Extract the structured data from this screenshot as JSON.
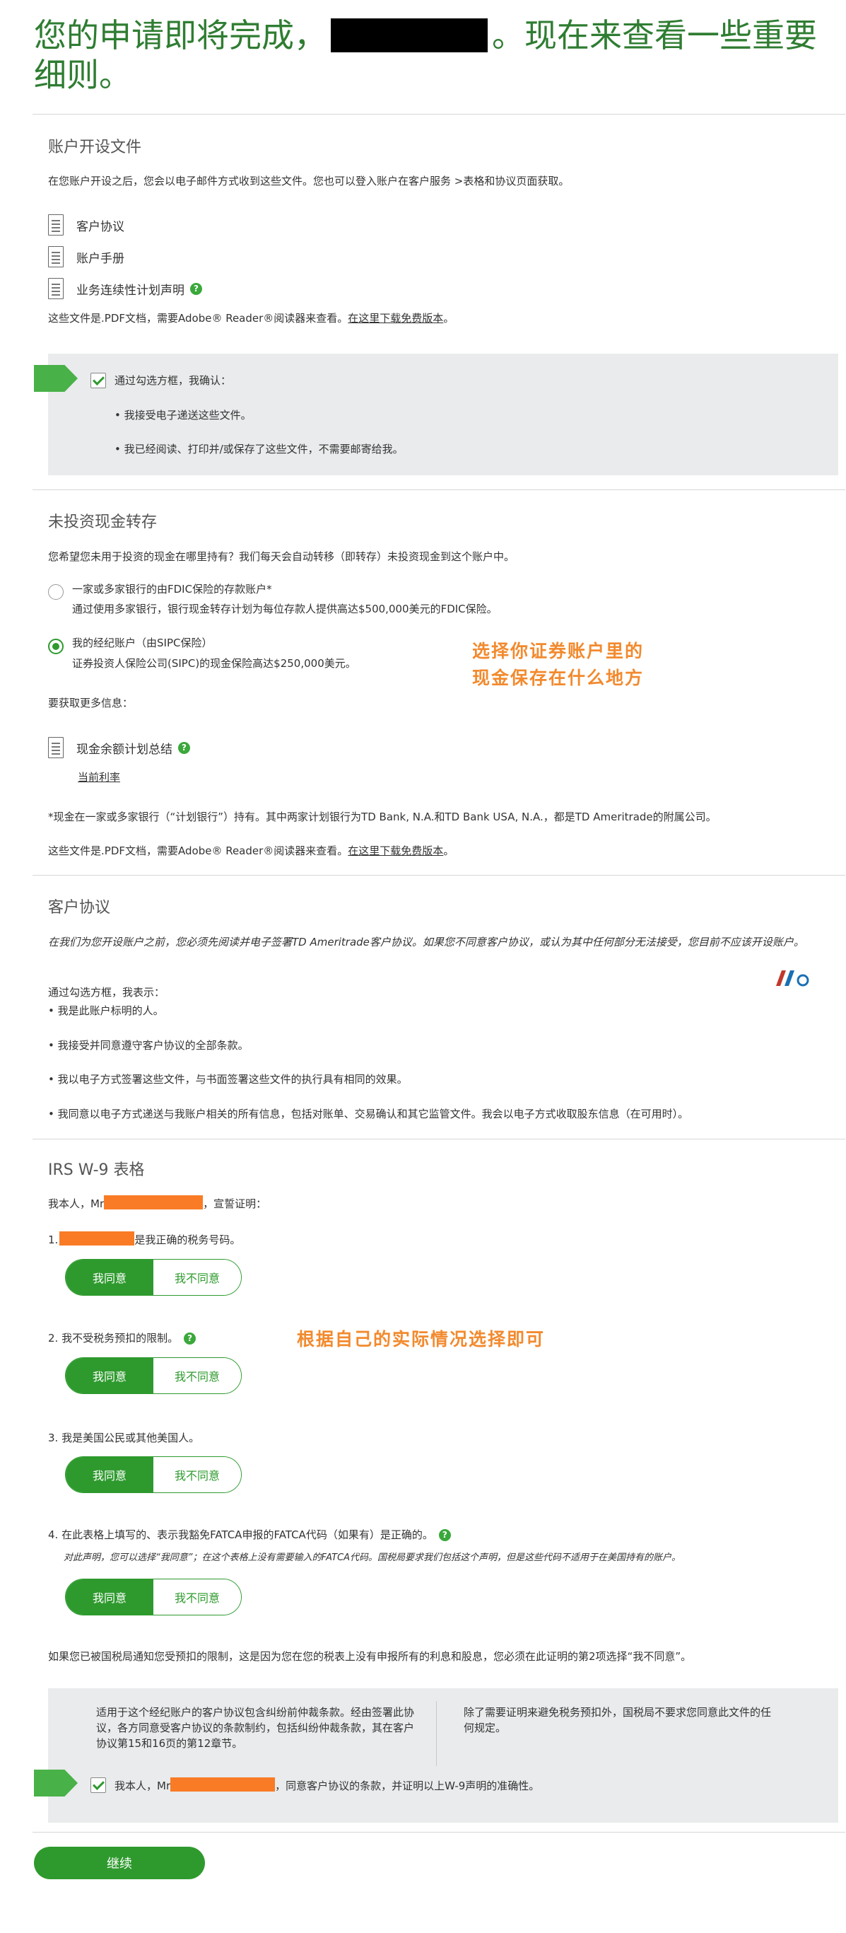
{
  "heading": {
    "part1": "您的申请即将完成，",
    "part2": "。现在来查看一些重要细则。"
  },
  "account_docs": {
    "title": "账户开设文件",
    "intro": "在您账户开设之后，您会以电子邮件方式收到这些文件。您也可以登入账户在客户服务 >表格和协议页面获取。",
    "docs": [
      "客户协议",
      "账户手册",
      "业务连续性计划声明"
    ],
    "pdf_note": "这些文件是.PDF文档，需要Adobe® Reader®阅读器来查看。",
    "pdf_link": "在这里下载免费版本",
    "pdf_end": "。",
    "confirm_label": "通过勾选方框，我确认：",
    "confirm_items": [
      "• 我接受电子递送这些文件。",
      "• 我已经阅读、打印并/或保存了这些文件，不需要邮寄给我。"
    ]
  },
  "cash": {
    "title": "未投资现金转存",
    "intro": "您希望您未用于投资的现金在哪里持有？我们每天会自动转移（即转存）未投资现金到这个账户中。",
    "option1_title": "一家或多家银行的由FDIC保险的存款账户*",
    "option1_desc": "通过使用多家银行，银行现金转存计划为每位存款人提供高达$500,000美元的FDIC保险。",
    "option2_title": "我的经纪账户（由SIPC保险）",
    "option2_desc": "证券投资人保险公司(SIPC)的现金保险高达$250,000美元。",
    "annotation_line1": "选择你证券账户里的",
    "annotation_line2": "现金保存在什么地方",
    "more_info": "要获取更多信息：",
    "doc": "现金余额计划总结",
    "rate_link": "当前利率",
    "footnote": "*现金在一家或多家银行（“计划银行”）持有。其中两家计划银行为TD Bank, N.A.和TD Bank USA, N.A.，都是TD Ameritrade的附属公司。",
    "pdf_note": "这些文件是.PDF文档，需要Adobe® Reader®阅读器来查看。",
    "pdf_link": "在这里下载免费版本",
    "pdf_end": "。"
  },
  "agreement": {
    "title": "客户协议",
    "intro": "在我们为您开设账户之前，您必须先阅读并电子签署TD Ameritrade客户协议。如果您不同意客户协议，或认为其中任何部分无法接受，您目前不应该开设账户。",
    "lead": "通过勾选方框，我表示：",
    "items": [
      "• 我是此账户标明的人。",
      "• 我接受并同意遵守客户协议的全部条款。",
      "• 我以电子方式签署这些文件，与书面签署这些文件的执行具有相同的效果。",
      "• 我同意以电子方式递送与我账户相关的所有信息，包括对账单、交易确认和其它监管文件。我会以电子方式收取股东信息（在可用时）。"
    ]
  },
  "w9": {
    "title": "IRS W-9 表格",
    "intro_prefix": "我本人，Mr",
    "intro_suffix": "，宣誓证明：",
    "item1_prefix": "1.",
    "item1_suffix": "是我正确的税务号码。",
    "item2": "2.  我不受税务预扣的限制。",
    "item3": "3.  我是美国公民或其他美国人。",
    "item4": "4.  在此表格上填写的、表示我豁免FATCA申报的FATCA代码（如果有）是正确的。",
    "item4_note": "对此声明，您可以选择“我同意”；在这个表格上没有需要输入的FATCA代码。国税局要求我们包括这个声明，但是这些代码不适用于在美国持有的账户。",
    "agree": "我同意",
    "disagree": "我不同意",
    "annotation": "根据自己的实际情况选择即可",
    "withholding_note": "如果您已被国税局通知您受预扣的限制，这是因为您在您的税表上没有申报所有的利息和股息，您必须在此证明的第2项选择“我不同意”。",
    "box_left": "适用于这个经纪账户的客户协议包含纠纷前仲裁条款。经由签署此协议，各方同意受客户协议的条款制约，包括纠纷仲裁条款，其在客户协议第15和16页的第12章节。",
    "box_right": "除了需要证明来避免税务预扣外，国税局不要求您同意此文件的任何规定。",
    "final_prefix": "我本人，Mr",
    "final_suffix": "，同意客户协议的条款，并证明以上W-9声明的准确性。"
  },
  "continue_label": "继续",
  "colors": {
    "green": "#2e9a2e",
    "annotation": "#f28a2e",
    "redaction": "#f97b25"
  }
}
